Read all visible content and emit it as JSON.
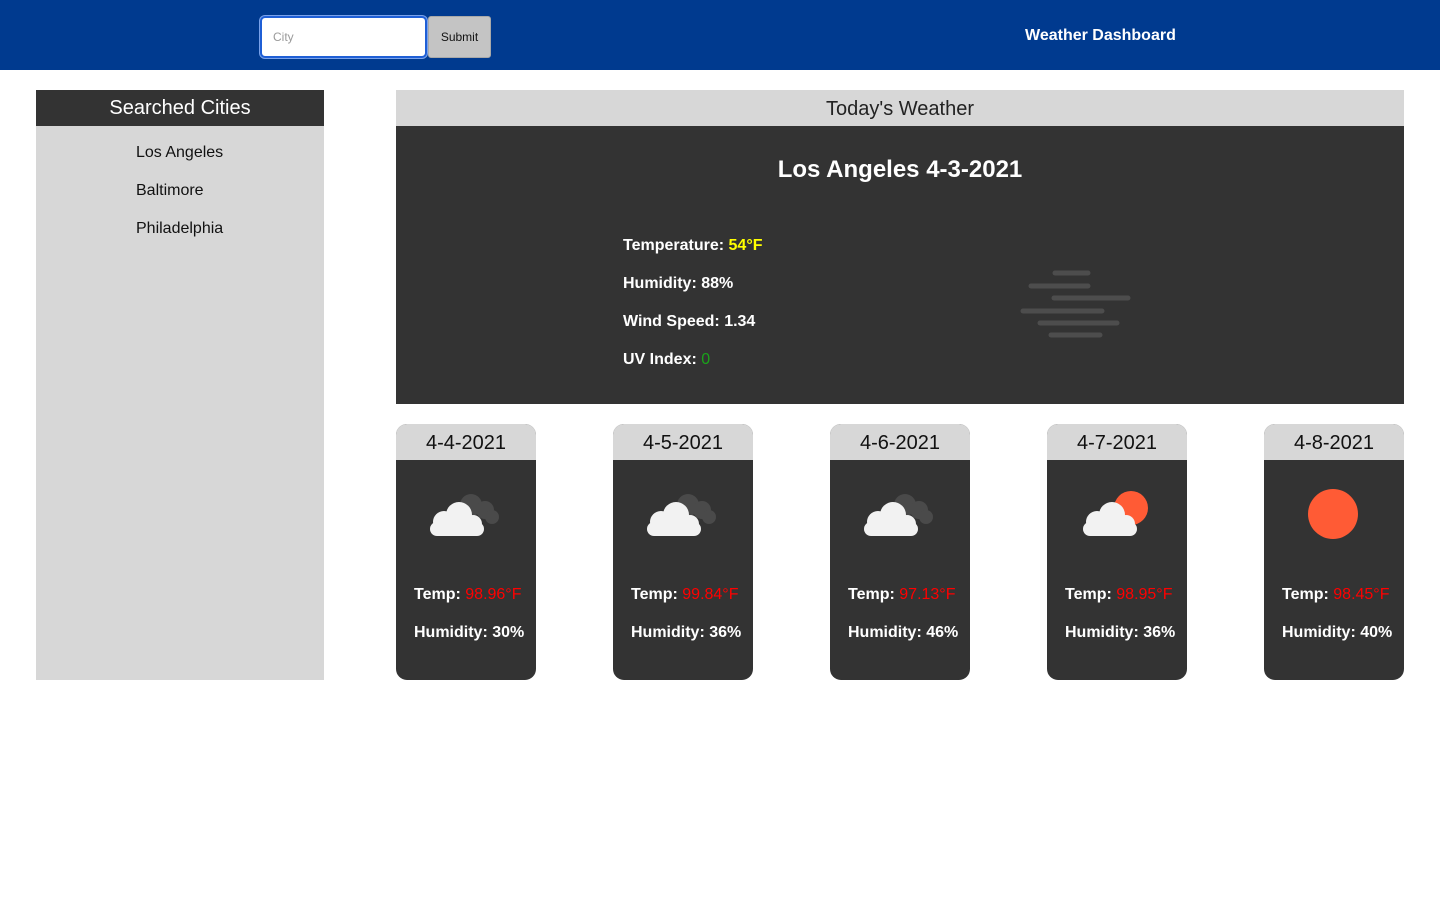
{
  "header": {
    "title": "Weather Dashboard",
    "search_placeholder": "City",
    "submit_label": "Submit",
    "background_color": "#003a8f"
  },
  "sidebar": {
    "title": "Searched Cities",
    "cities": [
      "Los Angeles",
      "Baltimore",
      "Philadelphia"
    ]
  },
  "today": {
    "section_title": "Today's Weather",
    "city_date": "Los Angeles 4-3-2021",
    "temperature_label": "Temperature:",
    "temperature_value": "54°F",
    "humidity": "Humidity: 88%",
    "wind_speed": "Wind Speed: 1.34",
    "uv_label": "UV Index:",
    "uv_value": "0",
    "icon": "mist-icon"
  },
  "forecast": [
    {
      "date": "4-4-2021",
      "icon": "broken-clouds-icon",
      "temp_label": "Temp:",
      "temp_value": "98.96°F",
      "humidity": "Humidity: 30%"
    },
    {
      "date": "4-5-2021",
      "icon": "broken-clouds-icon",
      "temp_label": "Temp:",
      "temp_value": "99.84°F",
      "humidity": "Humidity: 36%"
    },
    {
      "date": "4-6-2021",
      "icon": "broken-clouds-icon",
      "temp_label": "Temp:",
      "temp_value": "97.13°F",
      "humidity": "Humidity: 46%"
    },
    {
      "date": "4-7-2021",
      "icon": "few-clouds-sun-icon",
      "temp_label": "Temp:",
      "temp_value": "98.95°F",
      "humidity": "Humidity: 36%"
    },
    {
      "date": "4-8-2021",
      "icon": "clear-sun-icon",
      "temp_label": "Temp:",
      "temp_value": "98.45°F",
      "humidity": "Humidity: 40%"
    }
  ]
}
